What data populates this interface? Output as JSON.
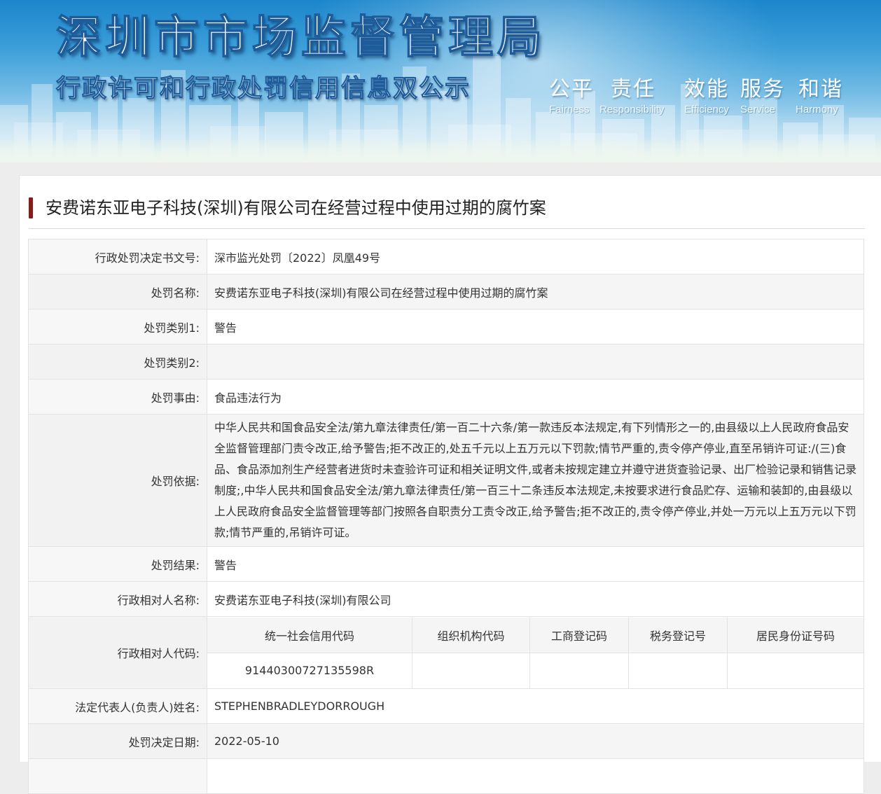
{
  "banner": {
    "title": "深圳市市场监督管理局",
    "subtitle": "行政许可和行政处罚信用信息双公示",
    "slogans": [
      {
        "cn": "公平",
        "en": "Fairness"
      },
      {
        "cn": "责任",
        "en": "Responsibility"
      },
      {
        "cn": "效能",
        "en": "Efficiency"
      },
      {
        "cn": "服务",
        "en": "Service"
      },
      {
        "cn": "和谐",
        "en": "Harmony"
      }
    ],
    "colors": {
      "sky_top": "#1b86cc",
      "sky_bottom": "#e7f3f5",
      "title_stroke": "#1d5b9a"
    }
  },
  "case": {
    "heading": "安费诺东亚电子科技(深圳)有限公司在经营过程中使用过期的腐竹案",
    "accent_color": "#8b1a1a"
  },
  "fields": {
    "decision_no": {
      "label": "行政处罚决定书文号:",
      "value": "深市监光处罚〔2022〕凤凰49号"
    },
    "penalty_name": {
      "label": "处罚名称:",
      "value": "安费诺东亚电子科技(深圳)有限公司在经营过程中使用过期的腐竹案"
    },
    "category1": {
      "label": "处罚类别1:",
      "value": "警告"
    },
    "category2": {
      "label": "处罚类别2:",
      "value": ""
    },
    "cause": {
      "label": "处罚事由:",
      "value": "食品违法行为"
    },
    "basis": {
      "label": "处罚依据:",
      "value": "中华人民共和国食品安全法/第九章法律责任/第一百二十六条/第一款违反本法规定,有下列情形之一的,由县级以上人民政府食品安全监督管理部门责令改正,给予警告;拒不改正的,处五千元以上五万元以下罚款;情节严重的,责令停产停业,直至吊销许可证:/(三)食品、食品添加剂生产经营者进货时未查验许可证和相关证明文件,或者未按规定建立并遵守进货查验记录、出厂检验记录和销售记录制度;,中华人民共和国食品安全法/第九章法律责任/第一百三十二条违反本法规定,未按要求进行食品贮存、运输和装卸的,由县级以上人民政府食品安全监督管理等部门按照各自职责分工责令改正,给予警告;拒不改正的,责令停产停业,并处一万元以上五万元以下罚款;情节严重的,吊销许可证。"
    },
    "result": {
      "label": "处罚结果:",
      "value": "警告"
    },
    "party_name": {
      "label": "行政相对人名称:",
      "value": "安费诺东亚电子科技(深圳)有限公司"
    },
    "party_codes": {
      "label": "行政相对人代码:",
      "headers": [
        "统一社会信用代码",
        "组织机构代码",
        "工商登记码",
        "税务登记号",
        "居民身份证号码"
      ],
      "values": [
        "91440300727135598R",
        "",
        "",
        "",
        ""
      ]
    },
    "legal_rep": {
      "label": "法定代表人(负责人)姓名:",
      "value": "STEPHENBRADLEYDORROUGH"
    },
    "decision_date": {
      "label": "处罚决定日期:",
      "value": "2022-05-10"
    }
  }
}
